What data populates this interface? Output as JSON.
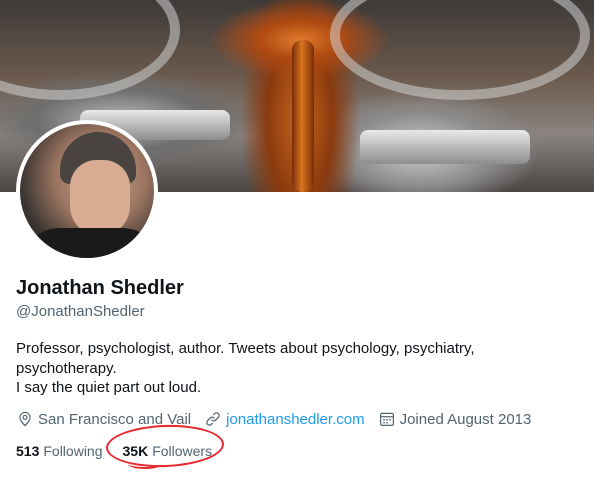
{
  "profile": {
    "name": "Jonathan Shedler",
    "handle": "@JonathanShedler",
    "bio_lines": [
      "Professor, psychologist, author. Tweets about psychology, psychiatry,",
      "psychotherapy.",
      "I say the quiet part out loud."
    ],
    "location": "San Francisco and Vail",
    "website": "jonathanshedler.com",
    "joined": "Joined August 2013"
  },
  "stats": {
    "following_count": "513",
    "following_label": "Following",
    "followers_count": "35K",
    "followers_label": "Followers"
  },
  "annotation": {
    "color": "#e8262b"
  },
  "colors": {
    "link": "#1d9bf0",
    "secondary_text": "#536471",
    "primary_text": "#0f1419"
  },
  "icons": {
    "location": "location-pin-icon",
    "website": "link-icon",
    "joined": "calendar-icon"
  }
}
